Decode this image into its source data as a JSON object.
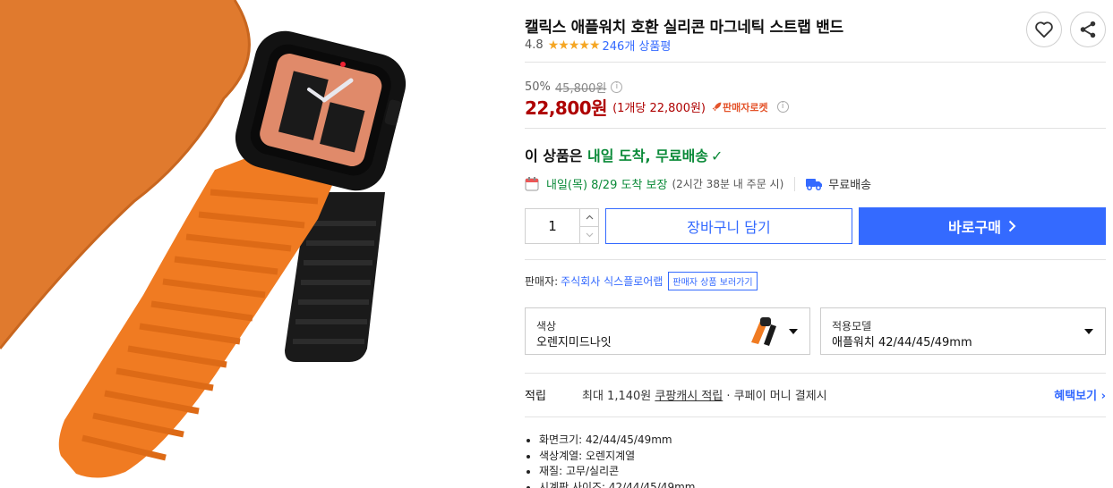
{
  "product": {
    "title": "캘릭스 애플워치 호환 실리콘 마그네틱 스트랩 밴드",
    "rating": "4.8",
    "review_count": "246개 상품평"
  },
  "price": {
    "discount_rate": "50%",
    "original_price": "45,800원",
    "sale_price": "22,800원",
    "unit_price": "(1개당 22,800원)",
    "badge": "판매자로켓"
  },
  "delivery": {
    "headline_prefix": "이 상품은 ",
    "headline_highlight": "내일 도착, 무료배송",
    "check": "✓",
    "date": "내일(목) 8/29 도착 보장",
    "note": "(2시간 38분 내 주문 시)",
    "shipping": "무료배송"
  },
  "purchase": {
    "quantity": "1",
    "cart_label": "장바구니 담기",
    "buy_label": "바로구매"
  },
  "seller": {
    "label": "판매자:",
    "name": "주식회사 식스플로어랩",
    "link": "판매자 상품 보러가기"
  },
  "options": [
    {
      "label": "색상",
      "value": "오렌지미드나잇"
    },
    {
      "label": "적용모델",
      "value": "애플워치 42/44/45/49mm"
    }
  ],
  "benefit": {
    "label": "적립",
    "text_prefix": "최대 1,140원 ",
    "text_link": "쿠팡캐시 적립",
    "text_suffix": " · 쿠페이 머니 결제시",
    "more": "혜택보기 ›"
  },
  "specs": [
    "화면크기: 42/44/45/49mm",
    "색상계열: 오렌지계열",
    "재질: 고무/실리콘",
    "시계판 사이즈: 42/44/45/49mm"
  ],
  "colors": {
    "accent": "#346aff",
    "price": "#ae0000",
    "delivery": "#0a8a38",
    "star": "#f5a623"
  }
}
